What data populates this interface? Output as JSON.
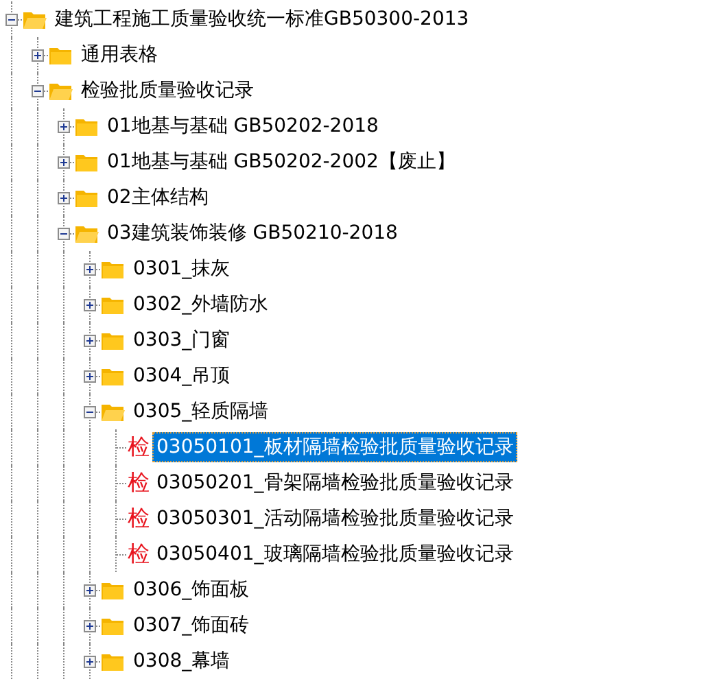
{
  "tree": [
    {
      "label": "建筑工程施工质量验收统一标准GB50300-2013",
      "kind": "folder",
      "expanded": true,
      "selected": false,
      "children": [
        {
          "label": "通用表格",
          "kind": "folder",
          "expanded": false,
          "selected": false
        },
        {
          "label": "检验批质量验收记录",
          "kind": "folder",
          "expanded": true,
          "selected": false,
          "children": [
            {
              "label": "01地基与基础 GB50202-2018",
              "kind": "folder",
              "expanded": false,
              "selected": false
            },
            {
              "label": "01地基与基础 GB50202-2002【废止】",
              "kind": "folder",
              "expanded": false,
              "selected": false
            },
            {
              "label": "02主体结构",
              "kind": "folder",
              "expanded": false,
              "selected": false
            },
            {
              "label": "03建筑装饰装修 GB50210-2018",
              "kind": "folder",
              "expanded": true,
              "selected": false,
              "children": [
                {
                  "label": "0301_抹灰",
                  "kind": "folder",
                  "expanded": false,
                  "selected": false
                },
                {
                  "label": "0302_外墙防水",
                  "kind": "folder",
                  "expanded": false,
                  "selected": false
                },
                {
                  "label": "0303_门窗",
                  "kind": "folder",
                  "expanded": false,
                  "selected": false
                },
                {
                  "label": "0304_吊顶",
                  "kind": "folder",
                  "expanded": false,
                  "selected": false
                },
                {
                  "label": "0305_轻质隔墙",
                  "kind": "folder",
                  "expanded": true,
                  "selected": false,
                  "children": [
                    {
                      "label": "03050101_板材隔墙检验批质量验收记录",
                      "kind": "record",
                      "glyph": "检",
                      "selected": true
                    },
                    {
                      "label": "03050201_骨架隔墙检验批质量验收记录",
                      "kind": "record",
                      "glyph": "检",
                      "selected": false
                    },
                    {
                      "label": "03050301_活动隔墙检验批质量验收记录",
                      "kind": "record",
                      "glyph": "检",
                      "selected": false
                    },
                    {
                      "label": "03050401_玻璃隔墙检验批质量验收记录",
                      "kind": "record",
                      "glyph": "检",
                      "selected": false
                    }
                  ]
                },
                {
                  "label": "0306_饰面板",
                  "kind": "folder",
                  "expanded": false,
                  "selected": false
                },
                {
                  "label": "0307_饰面砖",
                  "kind": "folder",
                  "expanded": false,
                  "selected": false
                },
                {
                  "label": "0308_幕墙",
                  "kind": "folder",
                  "expanded": false,
                  "selected": false
                }
              ]
            }
          ]
        }
      ]
    }
  ]
}
